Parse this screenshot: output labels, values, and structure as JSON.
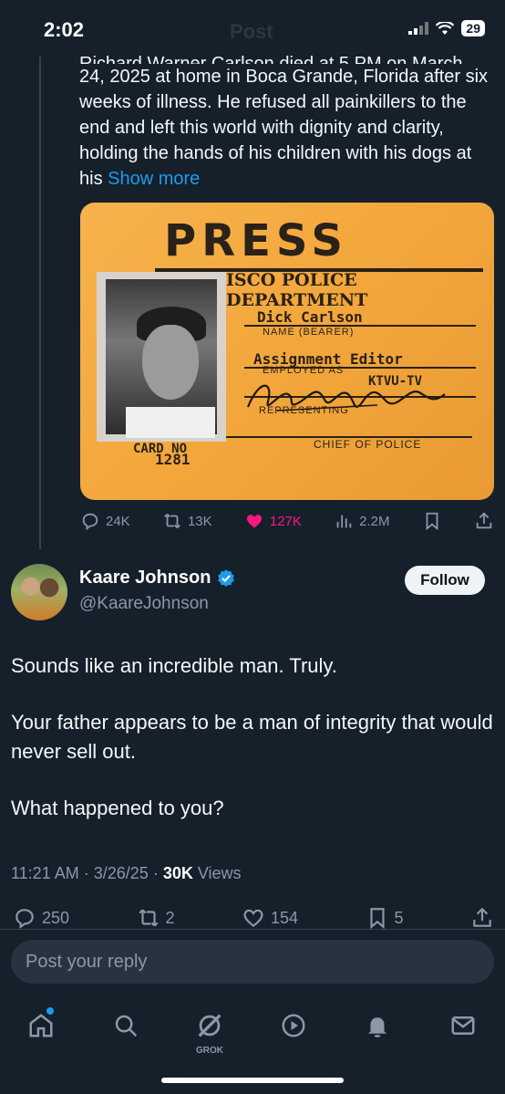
{
  "status_bar": {
    "time": "2:02",
    "battery": "29"
  },
  "header": {
    "ghost_title": "Post"
  },
  "original_post": {
    "text_cut_line": "Richard Warner Carlson died at 5 PM on March",
    "text": "24, 2025 at home in Boca Grande, Florida after six weeks of illness. He refused all painkillers to the end and left this world with dignity and clarity, holding the hands of his children with his dogs at his ",
    "show_more": "Show more",
    "image": {
      "press": "PRESS",
      "department": "ISCO POLICE DEPARTMENT",
      "name_value": "Dick Carlson",
      "name_label": "NAME (BEARER)",
      "assignment_value": "Assignment Editor",
      "employed_label": "EMPLOYED AS",
      "station_value": "KTVU-TV",
      "representing_label": "REPRESENTING",
      "card_no_label": "CARD NO",
      "card_no_value": "1281",
      "chief_label": "CHIEF OF POLICE"
    },
    "actions": {
      "replies": "24K",
      "reposts": "13K",
      "likes": "127K",
      "views": "2.2M"
    }
  },
  "reply": {
    "author_name": "Kaare Johnson",
    "author_handle": "@KaareJohnson",
    "follow_label": "Follow",
    "paragraphs": [
      "Sounds like an incredible man. Truly.",
      "Your father appears to be a man of integrity that would never sell out.",
      "What happened to you?"
    ],
    "time": "11:21 AM",
    "date": "3/26/25",
    "views_count": "30K",
    "views_label": "Views",
    "actions": {
      "replies": "250",
      "reposts": "2",
      "likes": "154",
      "bookmarks": "5"
    }
  },
  "composer": {
    "placeholder": "Post your reply"
  },
  "tab_bar": {
    "grok_label": "GROK"
  },
  "colors": {
    "background": "#15202b",
    "accent": "#1d9bf0",
    "like": "#f91880",
    "muted": "#8b98a5"
  }
}
